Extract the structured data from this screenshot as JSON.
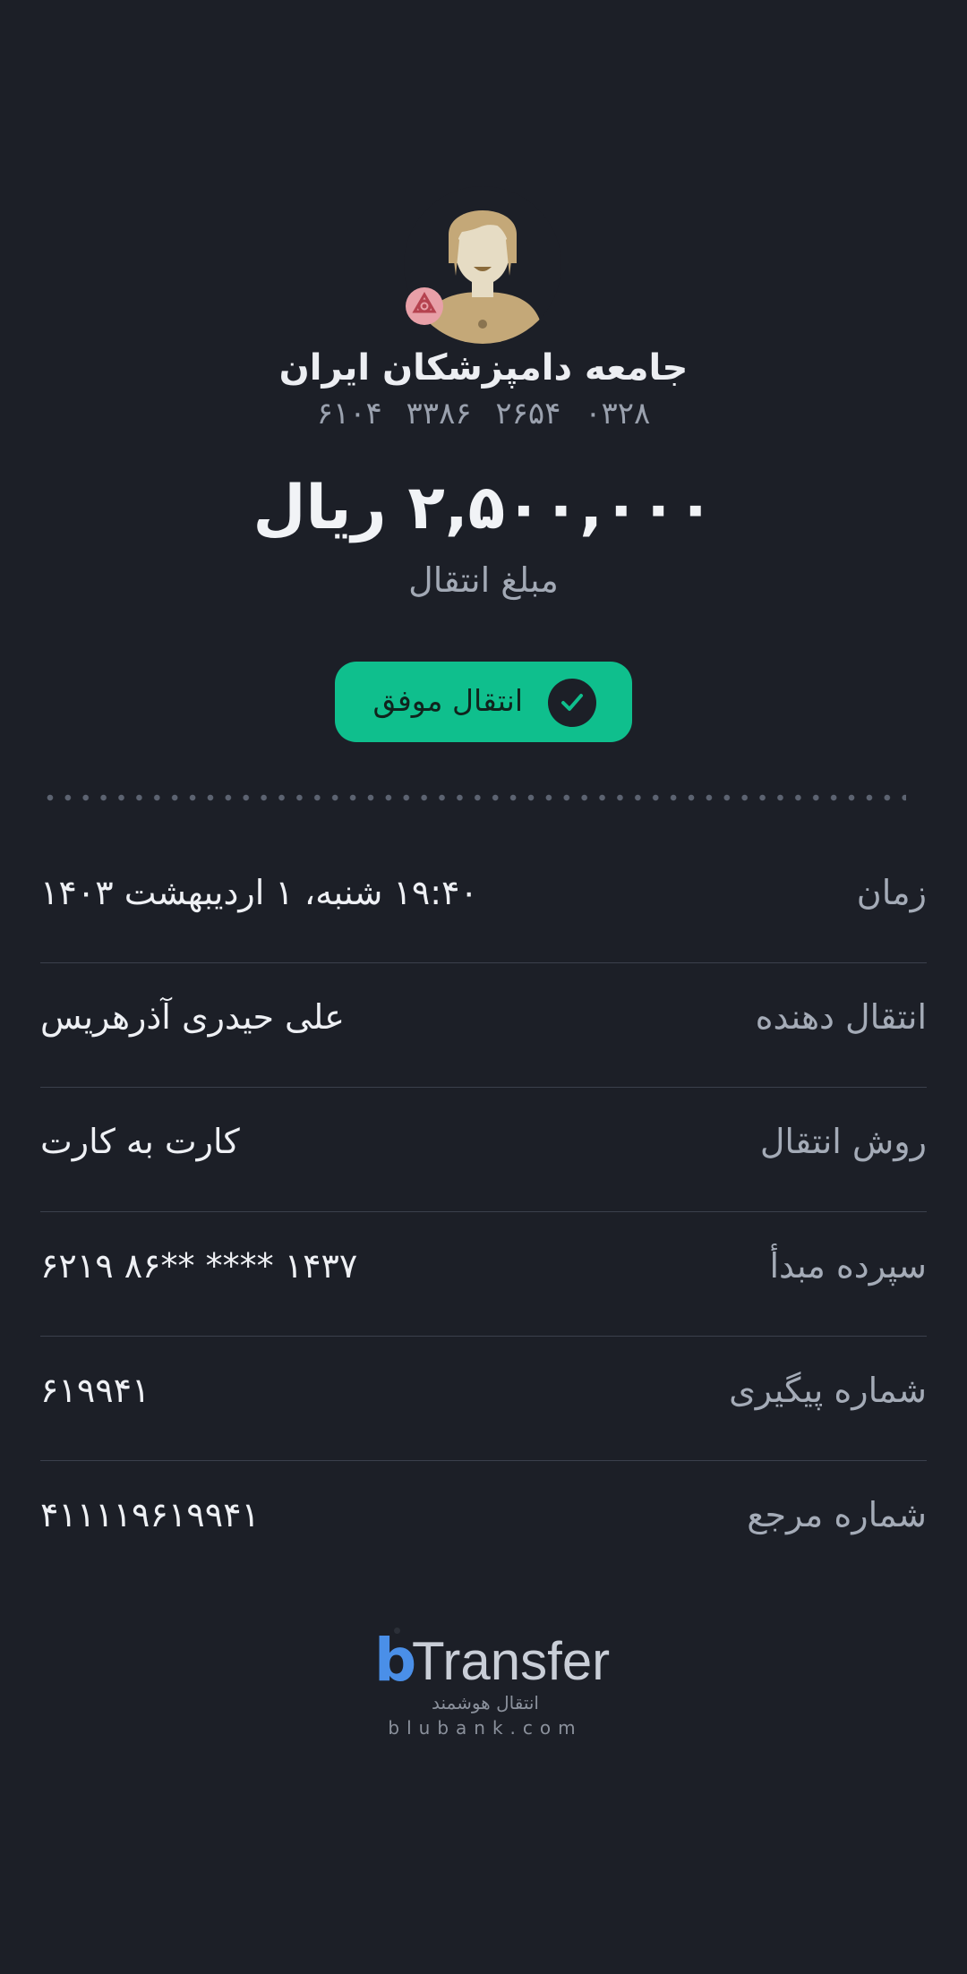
{
  "recipient": {
    "name": "جامعه دامپزشکان ایران",
    "card_number": "۶۱۰۴  ۳۳۸۶  ۲۶۵۴  ۰۳۲۸"
  },
  "transfer": {
    "amount": "۲,۵۰۰,۰۰۰ ریال",
    "amount_label": "مبلغ انتقال",
    "status": "انتقال موفق"
  },
  "details": [
    {
      "label": "زمان",
      "value": "۱۹:۴۰ شنبه، ۱ اردیبهشت ۱۴۰۳"
    },
    {
      "label": "انتقال دهنده",
      "value": "علی حیدری آذرهریس"
    },
    {
      "label": "روش انتقال",
      "value": "کارت به کارت"
    },
    {
      "label": "سپرده مبدأ",
      "value": "۶۲۱۹  ۸۶** **** ۱۴۳۷"
    },
    {
      "label": "شماره پیگیری",
      "value": "۶۱۹۹۴۱"
    },
    {
      "label": "شماره مرجع",
      "value": "۴۱۱۱۱۹۶۱۹۹۴۱"
    }
  ],
  "brand": {
    "logo_letter": "b",
    "logo_word": "Transfer",
    "tagline": "انتقال هوشمند",
    "site": "blubank.com"
  },
  "colors": {
    "background": "#1c1f27",
    "success": "#0fbf8d",
    "brand_blue": "#4a8fe8"
  },
  "icons": {
    "avatar": "avatar-icon",
    "bank": "bank-logo-icon",
    "status": "checkmark-icon"
  }
}
